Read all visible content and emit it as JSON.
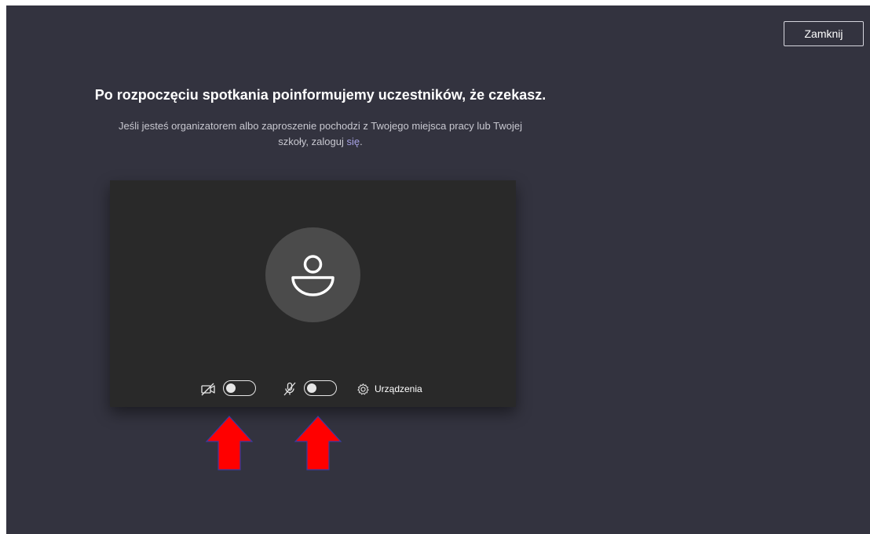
{
  "window": {
    "close_label": "Zamknij"
  },
  "main": {
    "heading": "Po rozpoczęciu spotkania poinformujemy uczestników, że czekasz.",
    "subtext_line1": "Jeśli jesteś organizatorem albo zaproszenie pochodzi z Twojego miejsca pracy lub Twojej",
    "subtext_line2": "szkoły, zaloguj ",
    "signin_link": "się",
    "subtext_end": "."
  },
  "controls": {
    "camera_icon": "camera-off-icon",
    "mic_icon": "mic-off-icon",
    "camera_on": false,
    "mic_on": false,
    "devices_label": "Urządzenia",
    "devices_icon": "gear-icon"
  },
  "annotations": {
    "arrow_color": "#ff0000",
    "arrow_icon": "up-arrow-icon"
  },
  "colors": {
    "background": "#33333f",
    "preview_bg": "#292929",
    "avatar_bg": "#4b4b4b",
    "link": "#a8a3e6"
  }
}
